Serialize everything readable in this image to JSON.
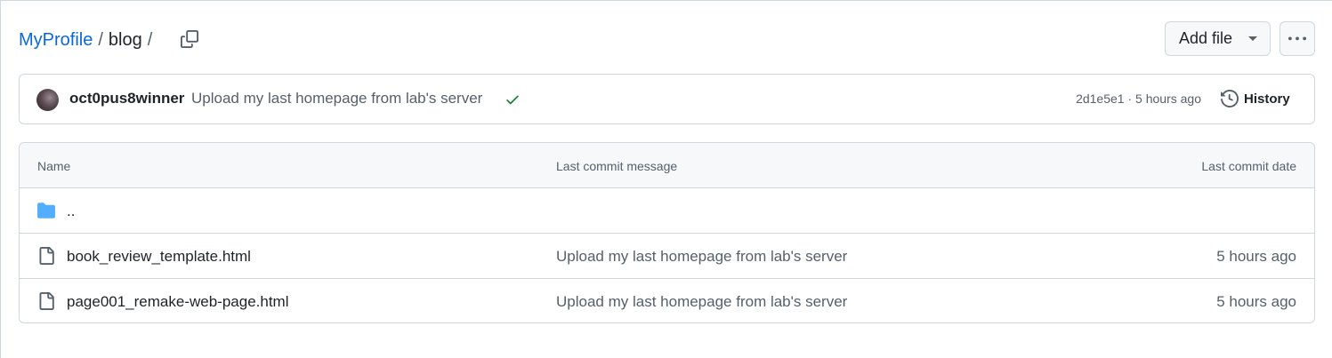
{
  "breadcrumb": {
    "repo": "MyProfile",
    "sep1": "/",
    "dir": "blog",
    "sep2": "/"
  },
  "actions": {
    "add_file_label": "Add file",
    "more_icon": "kebab-horizontal-icon",
    "copy_icon": "copy-icon"
  },
  "commit": {
    "author": "oct0pus8winner",
    "message": "Upload my last homepage from lab's server",
    "status": "success",
    "hash": "2d1e5e1",
    "meta_sep": " · ",
    "time": "5 hours ago",
    "history_label": "History",
    "colors": {
      "status": "#1a7f37",
      "link": "#0969da"
    }
  },
  "table": {
    "headers": {
      "name": "Name",
      "message": "Last commit message",
      "date": "Last commit date"
    },
    "parent": {
      "name": "..",
      "icon": "folder-icon"
    },
    "rows": [
      {
        "name": "book_review_template.html",
        "message": "Upload my last homepage from lab's server",
        "date": "5 hours ago",
        "icon": "file-icon"
      },
      {
        "name": "page001_remake-web-page.html",
        "message": "Upload my last homepage from lab's server",
        "date": "5 hours ago",
        "icon": "file-icon"
      }
    ]
  }
}
